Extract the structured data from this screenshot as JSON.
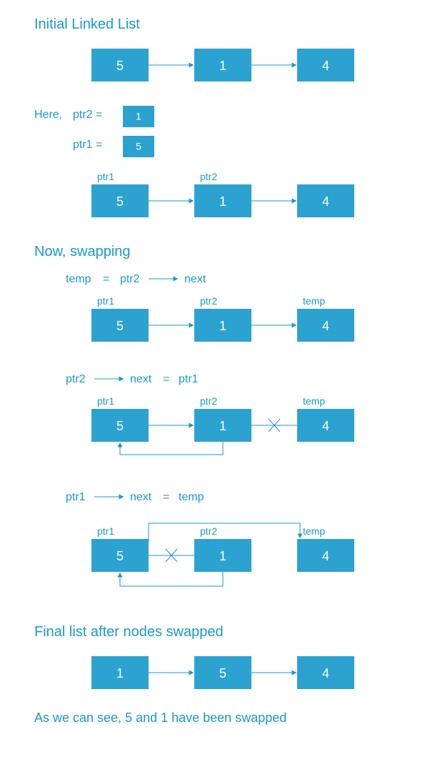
{
  "colors": {
    "accent": "#1a99c9",
    "node_fill": "#2ca2d0"
  },
  "headings": {
    "initial": "Initial Linked List",
    "here": "Here,",
    "ptr2eq": "ptr2  =",
    "ptr1eq": "ptr1  =",
    "now_swapping": "Now,   swapping",
    "final": "Final list after nodes swapped",
    "conclusion": "As we can see,  5 and 1 have been swapped"
  },
  "labels": {
    "ptr1": "ptr1",
    "ptr2": "ptr2",
    "temp": "temp",
    "next": "next"
  },
  "steps": {
    "s1": {
      "lhs": "temp",
      "eq": "=",
      "rhs1": "ptr2",
      "rhs2": "next"
    },
    "s2": {
      "lhs": "ptr2",
      "rhs1": "next",
      "eq": "=",
      "rhs2": "ptr1"
    },
    "s3": {
      "lhs": "ptr1",
      "rhs1": "next",
      "eq": "=",
      "rhs2": "temp"
    }
  },
  "nodes": {
    "initial": [
      "5",
      "1",
      "4"
    ],
    "small_ptr2": "1",
    "small_ptr1": "5",
    "labeled": [
      "5",
      "1",
      "4"
    ],
    "step1": [
      "5",
      "1",
      "4"
    ],
    "step2": [
      "5",
      "1",
      "4"
    ],
    "step3": [
      "5",
      "1",
      "4"
    ],
    "final": [
      "1",
      "5",
      "4"
    ]
  }
}
